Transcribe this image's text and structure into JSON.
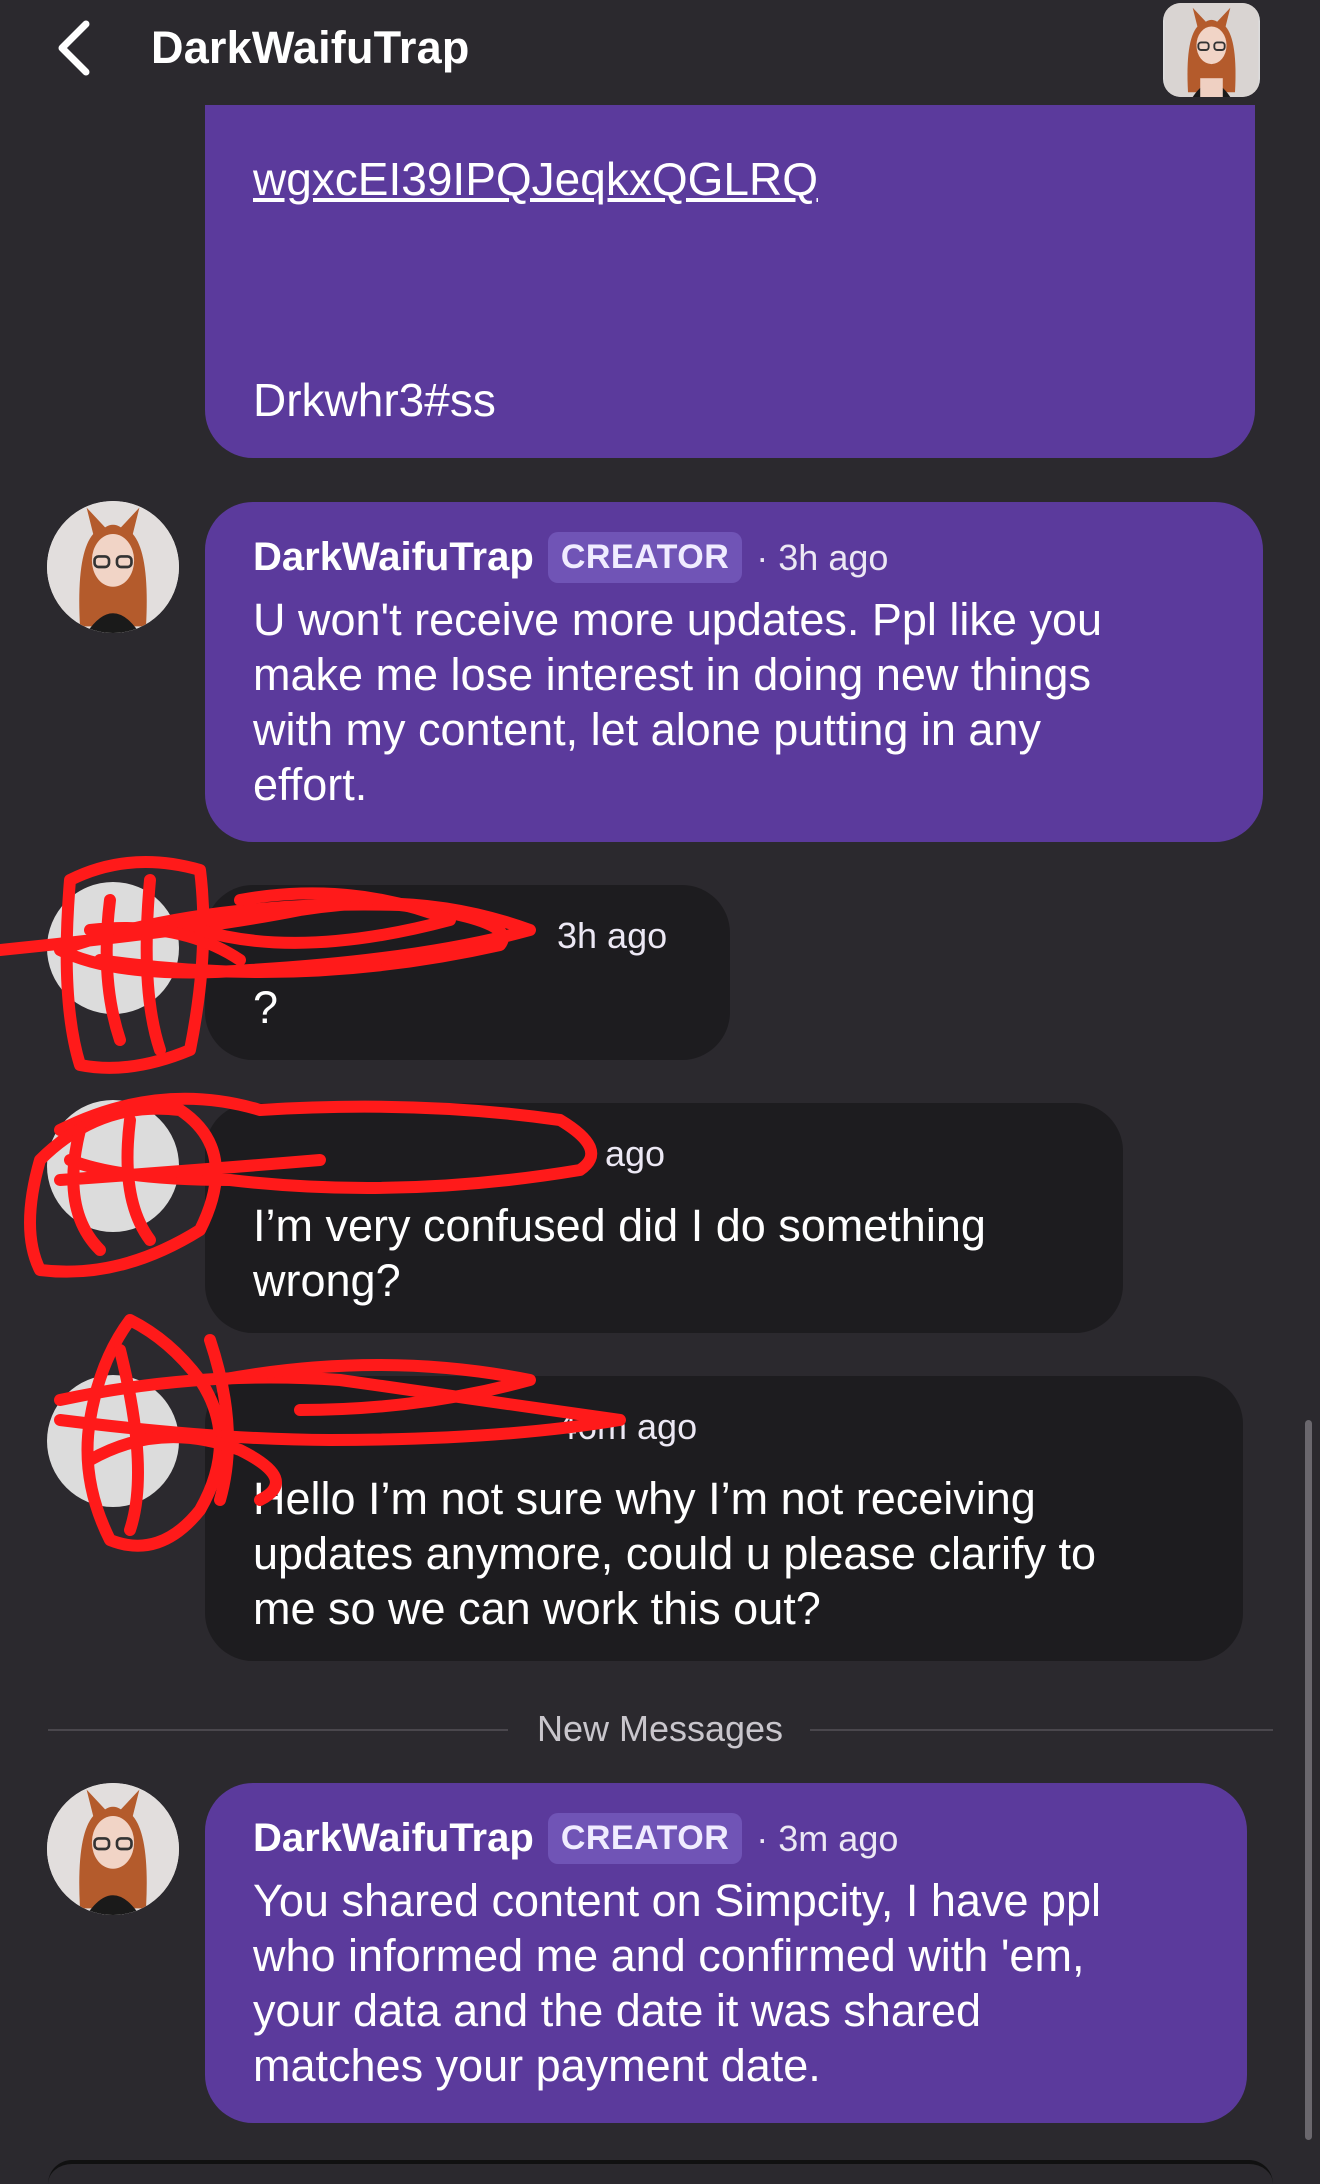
{
  "header": {
    "title": "DarkWaifuTrap"
  },
  "messages": [
    {
      "link_text": "wgxcEI39IPQJeqkxQGLRQ",
      "password_text": "Drkwhr3#ss"
    },
    {
      "author": "DarkWaifuTrap",
      "badge": "CREATOR",
      "time": "· 3h ago",
      "lines": [
        "U won't receive more updates.  Ppl  like you",
        "make me lose interest in doing new things",
        "with my content, let alone putting in any",
        "effort."
      ]
    },
    {
      "time": "3h ago",
      "lines": [
        "?"
      ]
    },
    {
      "time": "ago",
      "lines": [
        "I’m very confused did I do something",
        "wrong?"
      ]
    },
    {
      "time": "46m ago",
      "lines": [
        "Hello I’m not sure why I’m not receiving",
        "updates anymore, could u please clarify to",
        "me so we can work this out?"
      ]
    },
    {
      "author": "DarkWaifuTrap",
      "badge": "CREATOR",
      "time": "· 3m ago",
      "lines": [
        "You shared content on Simpcity, I have ppl",
        "who informed me and confirmed with 'em,",
        "your data and the date it was shared",
        "matches your payment date."
      ]
    }
  ],
  "divider_label": "New Messages",
  "colors": {
    "background": "#2b292e",
    "creator_bubble": "#5b3a9c",
    "fan_bubble": "#1d1c1f",
    "badge": "#7054b6",
    "redaction": "#ff1a1a"
  },
  "icons": {
    "back": "chevron-left-icon"
  }
}
